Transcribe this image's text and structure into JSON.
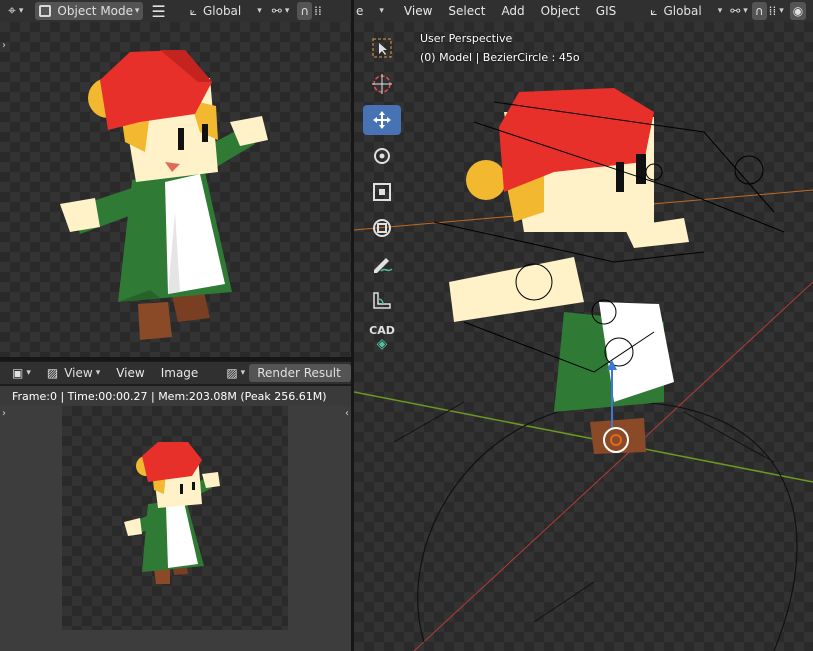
{
  "left_header": {
    "mode_label": "Object Mode",
    "transform_orientation": "Global"
  },
  "right_header": {
    "truncated_label": "e",
    "menus": [
      "View",
      "Select",
      "Add",
      "Object",
      "GIS"
    ],
    "transform_orientation": "Global"
  },
  "viewport": {
    "perspective_label": "User Perspective",
    "object_info": "(0) Model | BezierCircle : 45o",
    "cad_label": "CAD"
  },
  "image_editor": {
    "view_menu": "View",
    "view2_menu": "View",
    "image_menu": "Image",
    "image_name": "Render Result",
    "status": "Frame:0 | Time:00:00.27 | Mem:203.08M (Peak 256.61M)"
  },
  "colors": {
    "accent": "#4772b3",
    "x_axis": "#b33b3b",
    "y_axis": "#6a9a1f",
    "hat": "#e8302a",
    "dress": "#2f7a34",
    "apron": "#ffffff",
    "skin": "#fff2c8",
    "hair": "#f2b830",
    "boots": "#8a4a28"
  }
}
